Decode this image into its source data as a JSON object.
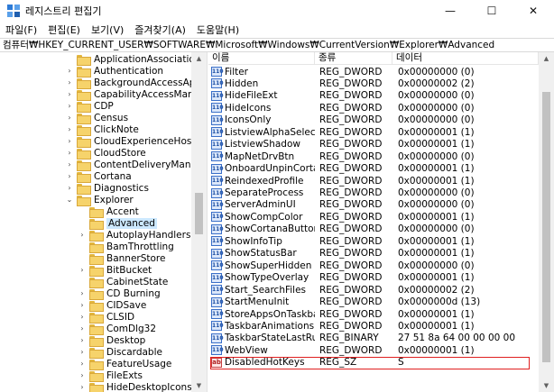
{
  "window": {
    "title": "레지스트리 편집기",
    "minimize": "—",
    "maximize": "☐",
    "close": "✕"
  },
  "menu": [
    "파일(F)",
    "편집(E)",
    "보기(V)",
    "즐겨찾기(A)",
    "도움말(H)"
  ],
  "address": "컴퓨터₩HKEY_CURRENT_USER₩SOFTWARE₩Microsoft₩Windows₩CurrentVersion₩Explorer₩Advanced",
  "tree": [
    {
      "label": "ApplicationAssociationToasts",
      "exp": "",
      "level": 1
    },
    {
      "label": "Authentication",
      "exp": "›",
      "level": 1
    },
    {
      "label": "BackgroundAccessApplicatio",
      "exp": "›",
      "level": 1
    },
    {
      "label": "CapabilityAccessManager",
      "exp": "›",
      "level": 1
    },
    {
      "label": "CDP",
      "exp": "›",
      "level": 1
    },
    {
      "label": "Census",
      "exp": "›",
      "level": 1
    },
    {
      "label": "ClickNote",
      "exp": "›",
      "level": 1
    },
    {
      "label": "CloudExperienceHost",
      "exp": "›",
      "level": 1
    },
    {
      "label": "CloudStore",
      "exp": "›",
      "level": 1
    },
    {
      "label": "ContentDeliveryManager",
      "exp": "›",
      "level": 1
    },
    {
      "label": "Cortana",
      "exp": "›",
      "level": 1
    },
    {
      "label": "Diagnostics",
      "exp": "›",
      "level": 1
    },
    {
      "label": "Explorer",
      "exp": "⌄",
      "level": 1
    },
    {
      "label": "Accent",
      "exp": "",
      "level": 2
    },
    {
      "label": "Advanced",
      "exp": "",
      "level": 2,
      "selected": true
    },
    {
      "label": "AutoplayHandlers",
      "exp": "›",
      "level": 2
    },
    {
      "label": "BamThrottling",
      "exp": "",
      "level": 2
    },
    {
      "label": "BannerStore",
      "exp": "",
      "level": 2
    },
    {
      "label": "BitBucket",
      "exp": "›",
      "level": 2
    },
    {
      "label": "CabinetState",
      "exp": "",
      "level": 2
    },
    {
      "label": "CD Burning",
      "exp": "›",
      "level": 2
    },
    {
      "label": "CIDSave",
      "exp": "›",
      "level": 2
    },
    {
      "label": "CLSID",
      "exp": "›",
      "level": 2
    },
    {
      "label": "ComDlg32",
      "exp": "›",
      "level": 2
    },
    {
      "label": "Desktop",
      "exp": "›",
      "level": 2
    },
    {
      "label": "Discardable",
      "exp": "›",
      "level": 2
    },
    {
      "label": "FeatureUsage",
      "exp": "›",
      "level": 2
    },
    {
      "label": "FileExts",
      "exp": "›",
      "level": 2
    },
    {
      "label": "HideDesktopIcons",
      "exp": "›",
      "level": 2
    }
  ],
  "columns": {
    "name": "이름",
    "type": "종류",
    "data": "데이터"
  },
  "values": [
    {
      "name": "Filter",
      "type": "REG_DWORD",
      "data": "0x00000000 (0)",
      "icon": "dword"
    },
    {
      "name": "Hidden",
      "type": "REG_DWORD",
      "data": "0x00000002 (2)",
      "icon": "dword"
    },
    {
      "name": "HideFileExt",
      "type": "REG_DWORD",
      "data": "0x00000000 (0)",
      "icon": "dword"
    },
    {
      "name": "HideIcons",
      "type": "REG_DWORD",
      "data": "0x00000000 (0)",
      "icon": "dword"
    },
    {
      "name": "IconsOnly",
      "type": "REG_DWORD",
      "data": "0x00000000 (0)",
      "icon": "dword"
    },
    {
      "name": "ListviewAlphaSelect",
      "type": "REG_DWORD",
      "data": "0x00000001 (1)",
      "icon": "dword"
    },
    {
      "name": "ListviewShadow",
      "type": "REG_DWORD",
      "data": "0x00000001 (1)",
      "icon": "dword"
    },
    {
      "name": "MapNetDrvBtn",
      "type": "REG_DWORD",
      "data": "0x00000000 (0)",
      "icon": "dword"
    },
    {
      "name": "OnboardUnpinCortana",
      "type": "REG_DWORD",
      "data": "0x00000001 (1)",
      "icon": "dword"
    },
    {
      "name": "ReindexedProfile",
      "type": "REG_DWORD",
      "data": "0x00000001 (1)",
      "icon": "dword"
    },
    {
      "name": "SeparateProcess",
      "type": "REG_DWORD",
      "data": "0x00000000 (0)",
      "icon": "dword"
    },
    {
      "name": "ServerAdminUI",
      "type": "REG_DWORD",
      "data": "0x00000000 (0)",
      "icon": "dword"
    },
    {
      "name": "ShowCompColor",
      "type": "REG_DWORD",
      "data": "0x00000001 (1)",
      "icon": "dword"
    },
    {
      "name": "ShowCortanaButton",
      "type": "REG_DWORD",
      "data": "0x00000000 (0)",
      "icon": "dword"
    },
    {
      "name": "ShowInfoTip",
      "type": "REG_DWORD",
      "data": "0x00000001 (1)",
      "icon": "dword"
    },
    {
      "name": "ShowStatusBar",
      "type": "REG_DWORD",
      "data": "0x00000001 (1)",
      "icon": "dword"
    },
    {
      "name": "ShowSuperHidden",
      "type": "REG_DWORD",
      "data": "0x00000000 (0)",
      "icon": "dword"
    },
    {
      "name": "ShowTypeOverlay",
      "type": "REG_DWORD",
      "data": "0x00000001 (1)",
      "icon": "dword"
    },
    {
      "name": "Start_SearchFiles",
      "type": "REG_DWORD",
      "data": "0x00000002 (2)",
      "icon": "dword"
    },
    {
      "name": "StartMenuInit",
      "type": "REG_DWORD",
      "data": "0x0000000d (13)",
      "icon": "dword"
    },
    {
      "name": "StoreAppsOnTaskbar",
      "type": "REG_DWORD",
      "data": "0x00000001 (1)",
      "icon": "dword"
    },
    {
      "name": "TaskbarAnimations",
      "type": "REG_DWORD",
      "data": "0x00000001 (1)",
      "icon": "dword"
    },
    {
      "name": "TaskbarStateLastRun",
      "type": "REG_BINARY",
      "data": "27 51 8a 64 00 00 00 00",
      "icon": "dword"
    },
    {
      "name": "WebView",
      "type": "REG_DWORD",
      "data": "0x00000001 (1)",
      "icon": "dword"
    },
    {
      "name": "DisabledHotKeys",
      "type": "REG_SZ",
      "data": "S",
      "icon": "sz",
      "highlighted": true
    }
  ],
  "icons": {
    "dword": "110",
    "sz": "ab"
  },
  "colors": {
    "selection": "#cce8ff",
    "highlight_border": "#e02020",
    "folder": "#f6d36b"
  }
}
